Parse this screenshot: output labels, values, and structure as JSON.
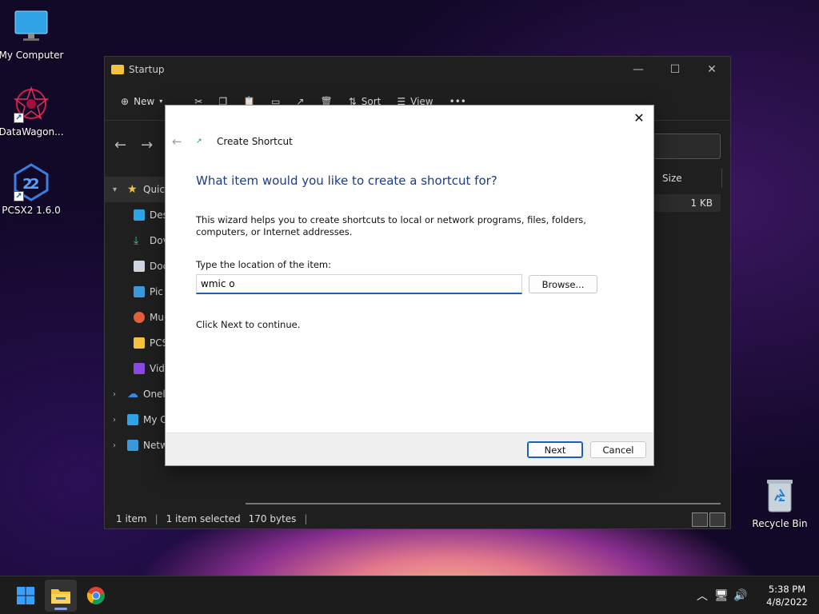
{
  "desktop": {
    "icons": [
      {
        "label": "My Computer"
      },
      {
        "label": "DataWagon..."
      },
      {
        "label": "PCSX2 1.6.0"
      },
      {
        "label": "Recycle Bin"
      }
    ]
  },
  "explorer": {
    "title": "Startup",
    "toolbar": {
      "new_label": "New",
      "sort_label": "Sort",
      "view_label": "View",
      "more_label": "•••"
    },
    "sidebar": [
      {
        "label": "Quic"
      },
      {
        "label": "Des"
      },
      {
        "label": "Dov"
      },
      {
        "label": "Doc"
      },
      {
        "label": "Pic"
      },
      {
        "label": "Mu"
      },
      {
        "label": "PCS"
      },
      {
        "label": "Vid"
      },
      {
        "label": "Onel"
      },
      {
        "label": "My C"
      },
      {
        "label": "Netwo"
      }
    ],
    "column_size": "Size",
    "row_size": "1 KB",
    "status": {
      "count": "1 item",
      "selected": "1 item selected",
      "bytes": "170 bytes"
    }
  },
  "dialog": {
    "title": "Create Shortcut",
    "heading": "What item would you like to create a shortcut for?",
    "description": "This wizard helps you to create shortcuts to local or network programs, files, folders, computers, or Internet addresses.",
    "location_label": "Type the location of the item:",
    "location_value": "wmic o",
    "browse_label": "Browse...",
    "continue_text": "Click Next to continue.",
    "next_label": "Next",
    "cancel_label": "Cancel"
  },
  "taskbar": {
    "time": "5:38 PM",
    "date": "4/8/2022"
  },
  "colors": {
    "accent": "#1c5fb8",
    "heading": "#1a3a8a"
  }
}
